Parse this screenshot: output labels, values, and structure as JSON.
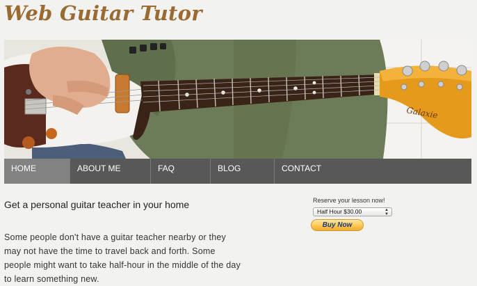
{
  "site": {
    "title": "Web Guitar Tutor"
  },
  "banner": {
    "headstock_brand": "Galaxie"
  },
  "nav": {
    "items": [
      {
        "label": "HOME",
        "active": true
      },
      {
        "label": "ABOUT ME",
        "active": false
      },
      {
        "label": "FAQ",
        "active": false
      },
      {
        "label": "BLOG",
        "active": false
      },
      {
        "label": "CONTACT",
        "active": false
      }
    ]
  },
  "main": {
    "headline": "Get a personal guitar teacher in your home",
    "body": "Some people don't have a guitar teacher nearby or they may not have the time to travel back and forth.  Some people might want to take half-hour in the middle of the day to learn something new."
  },
  "reserve": {
    "label": "Reserve your lesson now!",
    "selected_option": "Half Hour $30.00",
    "button_label": "Buy Now"
  },
  "colors": {
    "title": "#9a6a33",
    "nav_bg": "#585858",
    "nav_active": "#828282",
    "buy_button": "#ffcb58"
  }
}
